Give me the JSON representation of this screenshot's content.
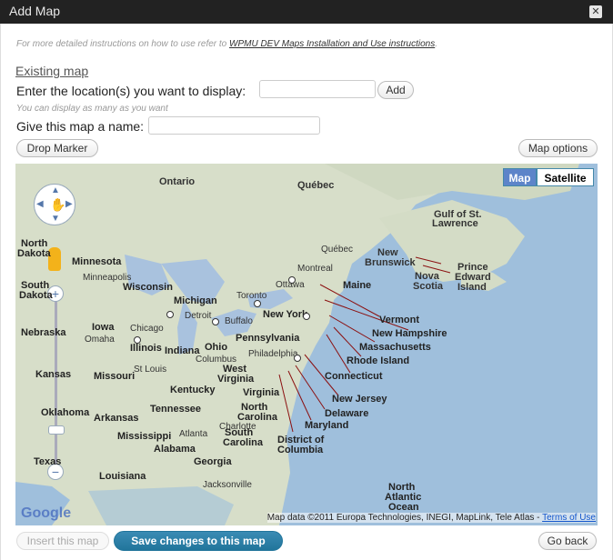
{
  "window": {
    "title": "Add Map",
    "close_glyph": "✕"
  },
  "help": {
    "text_before": "For more detailed instructions on how to use refer to ",
    "link_text": "WPMU DEV Maps Installation and Use instructions",
    "text_after": "."
  },
  "existing_map_link": "Existing map",
  "location": {
    "label": "Enter the location(s) you want to display:",
    "value": "",
    "add_button": "Add",
    "hint": "You can display as many as you want"
  },
  "map_name": {
    "label": "Give this map a name:",
    "value": ""
  },
  "buttons": {
    "drop_marker": "Drop Marker",
    "map_options": "Map options",
    "insert": "Insert this map",
    "save": "Save changes to this map",
    "go_back": "Go back"
  },
  "map": {
    "type_toggle": {
      "map": "Map",
      "satellite": "Satellite",
      "selected": "Map"
    },
    "credits_text": "Map data ©2011 Europa Technologies, INEGI, MapLink, Tele Atlas - ",
    "terms_link": "Terms of Use",
    "brand": "Google",
    "zoom_in": "+",
    "zoom_out": "−",
    "labels": {
      "ontario": "Ontario",
      "quebec": "Québec",
      "gulf": "Gulf of St.",
      "lawrence": "Lawrence",
      "quebec_city": "Québec",
      "montreal": "Montreal",
      "ottawa": "Ottawa",
      "toronto": "Toronto",
      "new": "New",
      "brunswick": "Brunswick",
      "nova": "Nova",
      "scotia": "Scotia",
      "prince": "Prince",
      "edward": "Edward",
      "island": "Island",
      "maine": "Maine",
      "vermont": "Vermont",
      "new_hampshire": "New Hampshire",
      "massachusetts": "Massachusetts",
      "rhode_island": "Rhode Island",
      "connecticut": "Connecticut",
      "new_jersey": "New Jersey",
      "delaware": "Delaware",
      "maryland": "Maryland",
      "district_of": "District of",
      "columbia": "Columbia",
      "north": "North",
      "dakota": "Dakota",
      "south": "South",
      "dakota2": "Dakota",
      "minnesota": "Minnesota",
      "minneapolis": "Minneapolis",
      "wisconsin": "Wisconsin",
      "michigan": "Michigan",
      "detroit": "Detroit",
      "buffalo": "Buffalo",
      "new_york": "New York",
      "pennsylvania": "Pennsylvania",
      "philadelphia": "Philadelphia",
      "iowa": "Iowa",
      "chicago": "Chicago",
      "nebraska": "Nebraska",
      "omaha": "Omaha",
      "illinois": "Illinois",
      "indiana": "Indiana",
      "ohio": "Ohio",
      "columbus": "Columbus",
      "west": "West",
      "virginia_w": "Virginia",
      "virginia": "Virginia",
      "kansas": "Kansas",
      "missouri": "Missouri",
      "st_louis": "St Louis",
      "kentucky": "Kentucky",
      "oklahoma": "Oklahoma",
      "arkansas": "Arkansas",
      "tennessee": "Tennessee",
      "north_c": "North",
      "carolina": "Carolina",
      "charlotte": "Charlotte",
      "south_c": "South",
      "carolina2": "Carolina",
      "mississippi": "Mississippi",
      "alabama": "Alabama",
      "atlanta": "Atlanta",
      "georgia": "Georgia",
      "texas": "Texas",
      "louisiana": "Louisiana",
      "jacksonville": "Jacksonville",
      "north_atlantic": "North",
      "atlantic": "Atlantic",
      "ocean": "Ocean"
    }
  }
}
